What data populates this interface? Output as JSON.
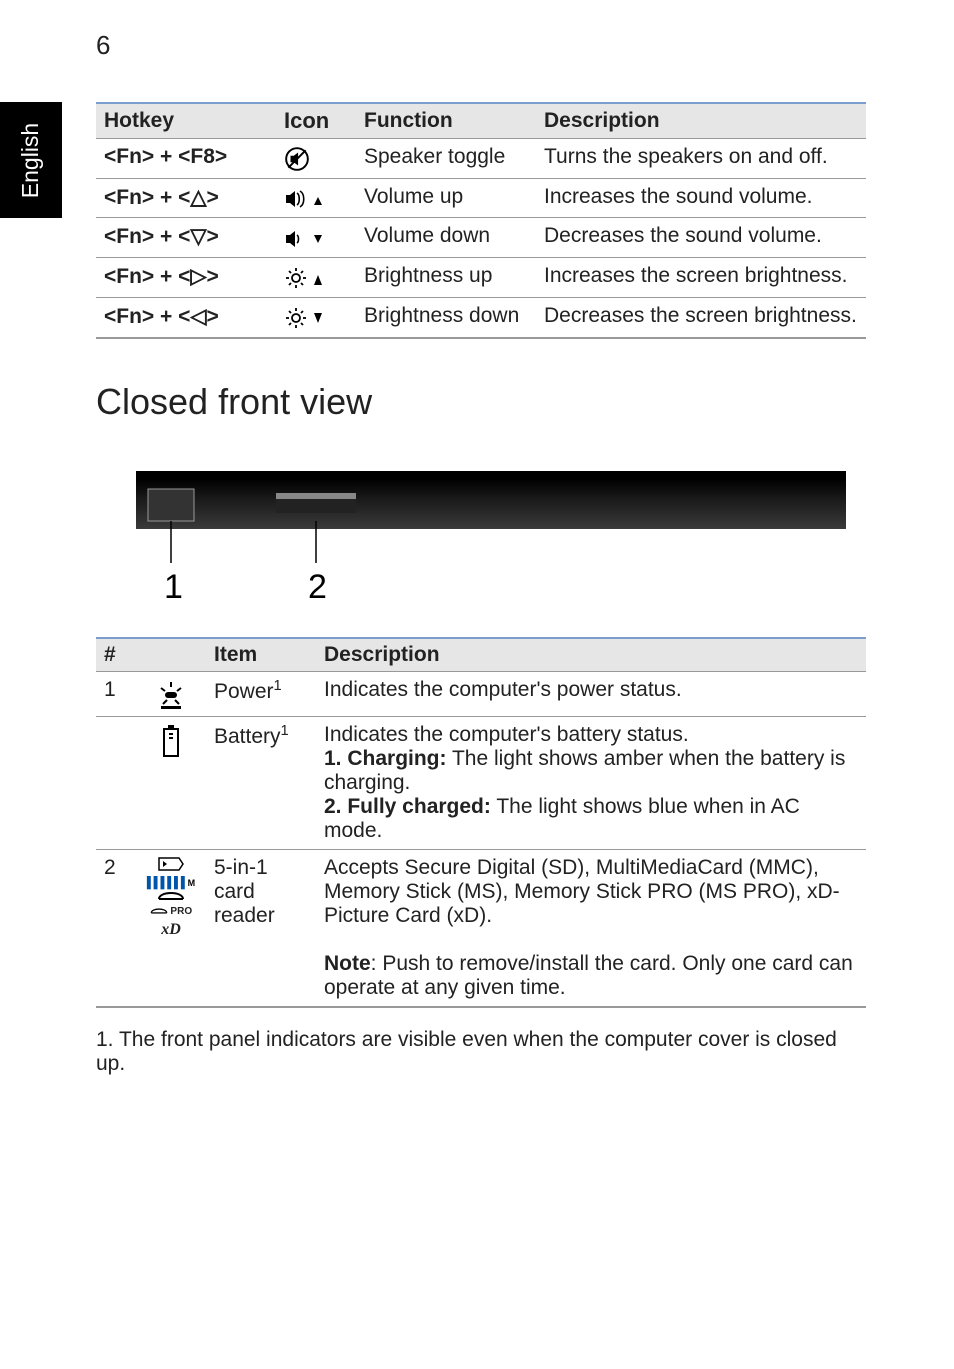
{
  "page_number": "6",
  "side_tab": "English",
  "hotkey_table": {
    "headers": {
      "hotkey": "Hotkey",
      "icon": "Icon",
      "func": "Function",
      "desc": "Description"
    },
    "rows": [
      {
        "hotkey": "<Fn> + <F8>",
        "icon_name": "speaker-mute-icon",
        "func": "Speaker toggle",
        "desc": "Turns the speakers on and off."
      },
      {
        "hotkey": "<Fn> + <△>",
        "icon_name": "volume-up-icon",
        "func": "Volume up",
        "desc": "Increases the sound volume."
      },
      {
        "hotkey": "<Fn> + <▽>",
        "icon_name": "volume-down-icon",
        "func": "Volume down",
        "desc": "Decreases the sound volume."
      },
      {
        "hotkey": "<Fn> + <▷>",
        "icon_name": "brightness-up-icon",
        "func": "Brightness up",
        "desc": "Increases the screen brightness."
      },
      {
        "hotkey": "<Fn> + <◁>",
        "icon_name": "brightness-down-icon",
        "func": "Brightness down",
        "desc": "Decreases the screen brightness."
      }
    ]
  },
  "section_heading": "Closed front view",
  "callouts": {
    "c1": "1",
    "c2": "2"
  },
  "front_table": {
    "headers": {
      "num": "#",
      "item": "Item",
      "desc": "Description"
    },
    "rows": [
      {
        "num": "1",
        "icon_name": "power-led-icon",
        "item": "Power",
        "item_sup": "1",
        "desc": "Indicates the computer's power status."
      },
      {
        "num": "",
        "icon_name": "battery-led-icon",
        "item": "Battery",
        "item_sup": "1",
        "desc_intro": "Indicates the computer's battery status.",
        "desc_line1_label": "1. Charging:",
        "desc_line1_rest": " The light shows amber when the battery is charging.",
        "desc_line2_label": "2. Fully charged:",
        "desc_line2_rest": " The light shows blue when in AC mode."
      },
      {
        "num": "2",
        "icon_name": "card-reader-icons",
        "item": "5-in-1 card reader",
        "desc_main": "Accepts Secure Digital (SD), MultiMediaCard (MMC), Memory Stick (MS), Memory Stick PRO (MS PRO), xD-Picture Card (xD).",
        "desc_note_label": "Note",
        "desc_note_rest": ": Push to remove/install the card. Only one card can operate at any given time."
      }
    ]
  },
  "footnote": "1. The front panel indicators are visible even when the computer cover is closed up."
}
